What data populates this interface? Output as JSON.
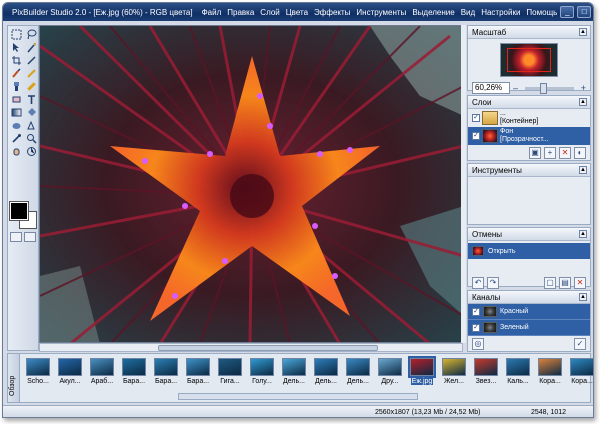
{
  "window": {
    "title": "PixBuilder Studio 2.0 - [Еж.jpg (60%) - RGB цвета]",
    "controls": [
      "_",
      "□",
      "✕",
      "_",
      "□",
      "✕"
    ]
  },
  "menu": [
    "Файл",
    "Правка",
    "Слой",
    "Цвета",
    "Эффекты",
    "Инструменты",
    "Выделение",
    "Вид",
    "Настройки",
    "Помощь"
  ],
  "toolbox": {
    "tools": [
      "select-rect-icon",
      "lasso-icon",
      "move-icon",
      "magic-wand-icon",
      "crop-icon",
      "slice-icon",
      "brush-icon",
      "pencil-icon",
      "clone-icon",
      "healing-icon",
      "eraser-icon",
      "text-icon",
      "gradient-icon",
      "fill-icon",
      "dodge-icon",
      "pen-icon",
      "eyedropper-icon",
      "zoom-icon",
      "hand-icon",
      "measure-icon"
    ],
    "foreground": "#000000",
    "background": "#ffffff"
  },
  "panels": {
    "scale": {
      "title": "Масштаб",
      "zoom_value": "60,26%",
      "zoom_level": 0.6026
    },
    "layers": {
      "title": "Слои",
      "items": [
        {
          "name": "...",
          "sub": "[Контейнер]"
        },
        {
          "name": "Фон",
          "sub": "[Прозрачност..."
        }
      ]
    },
    "tools": {
      "title": "Инструменты"
    },
    "history": {
      "title": "Отмены",
      "items": [
        "Открыть"
      ]
    },
    "channels": {
      "title": "Каналы",
      "items": [
        "Красный",
        "Зеленый"
      ]
    }
  },
  "filmstrip": {
    "tab_label": "Обзор",
    "items": [
      {
        "label": "Scho...",
        "color": "#3c8ac4"
      },
      {
        "label": "Акул...",
        "color": "#2366a8"
      },
      {
        "label": "Араб...",
        "color": "#4a8fbf"
      },
      {
        "label": "Бара...",
        "color": "#1e6ea0"
      },
      {
        "label": "Бара...",
        "color": "#2a7fb3"
      },
      {
        "label": "Бара...",
        "color": "#3d91c7"
      },
      {
        "label": "Гига...",
        "color": "#1e5a80"
      },
      {
        "label": "Голу...",
        "color": "#2f9ad0"
      },
      {
        "label": "Дель...",
        "color": "#4aa6d8"
      },
      {
        "label": "Дель...",
        "color": "#2c7db8"
      },
      {
        "label": "Дель...",
        "color": "#3888c2"
      },
      {
        "label": "Дру...",
        "color": "#6aa7cf"
      },
      {
        "label": "Еж.jpg",
        "color": "#b51e28"
      },
      {
        "label": "Жел...",
        "color": "#d6b431"
      },
      {
        "label": "Звез...",
        "color": "#c63a2a"
      },
      {
        "label": "Каль...",
        "color": "#2b7ab0"
      },
      {
        "label": "Кора...",
        "color": "#d9823a"
      },
      {
        "label": "Кора...",
        "color": "#2d88c0"
      }
    ]
  },
  "status": {
    "size": "2560x1807 (13,23 Mb / 24,52 Mb)",
    "coords": "2548, 1012"
  }
}
